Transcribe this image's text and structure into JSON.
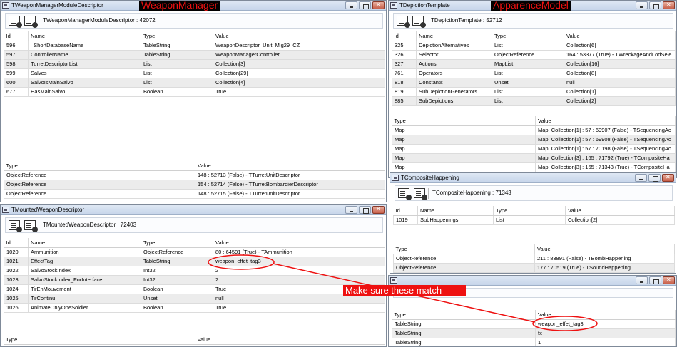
{
  "windows": {
    "weapon_manager": {
      "title": "TWeaponManagerModuleDescriptor",
      "red_label": "WeaponManager",
      "toolbar_title": "TWeaponManagerModuleDescriptor : 42072",
      "headers": [
        "Id",
        "Name",
        "Type",
        "Value"
      ],
      "rows": [
        [
          "596",
          "_ShortDatabaseName",
          "TableString",
          "WeaponDescriptor_Unit_Mig29_CZ"
        ],
        [
          "597",
          "ControllerName",
          "TableString",
          "WeaponManagerController"
        ],
        [
          "598",
          "TurretDescriptorList",
          "List",
          "Collection[3]"
        ],
        [
          "599",
          "Salves",
          "List",
          "Collection[29]"
        ],
        [
          "600",
          "SalvoIsMainSalvo",
          "List",
          "Collection[4]"
        ],
        [
          "677",
          "HasMainSalvo",
          "Boolean",
          "True"
        ]
      ],
      "sub_headers": [
        "Type",
        "Value"
      ],
      "sub_rows": [
        [
          "ObjectReference",
          "148 : 52713 (False) - TTurretUnitDescriptor"
        ],
        [
          "ObjectReference",
          "154 : 52714 (False) - TTurretBombardierDescriptor"
        ],
        [
          "ObjectReference",
          "148 : 52715 (False) - TTurretUnitDescriptor"
        ]
      ]
    },
    "mounted_weapon": {
      "title": "TMountedWeaponDescriptor",
      "toolbar_title": "TMountedWeaponDescriptor : 72403",
      "headers": [
        "Id",
        "Name",
        "Type",
        "Value"
      ],
      "rows": [
        [
          "1020",
          "Ammunition",
          "ObjectReference",
          "80 : 64591 (True) - TAmmunition"
        ],
        [
          "1021",
          "EffectTag",
          "TableString",
          "weapon_effet_tag3"
        ],
        [
          "1022",
          "SalvoStockIndex",
          "Int32",
          "2"
        ],
        [
          "1023",
          "SalvoStockIndex_ForInterface",
          "Int32",
          "2"
        ],
        [
          "1024",
          "TirEnMouvement",
          "Boolean",
          "True"
        ],
        [
          "1025",
          "TirContinu",
          "Unset",
          "null"
        ],
        [
          "1026",
          "AnimateOnlyOneSoldier",
          "Boolean",
          "True"
        ]
      ],
      "sub_headers": [
        "Type",
        "Value"
      ]
    },
    "depiction": {
      "title": "TDepictionTemplate",
      "red_label": "ApparenceModel",
      "toolbar_title": "TDepictionTemplate : 52712",
      "headers": [
        "Id",
        "Name",
        "Type",
        "Value"
      ],
      "rows": [
        [
          "325",
          "DepictionAlternatives",
          "List",
          "Collection[6]"
        ],
        [
          "326",
          "Selector",
          "ObjectReference",
          "164 : 53377 (True) - TWreckageAndLodSele"
        ],
        [
          "327",
          "Actions",
          "MapList",
          "Collection[16]"
        ],
        [
          "761",
          "Operators",
          "List",
          "Collection[8]"
        ],
        [
          "818",
          "Constants",
          "Unset",
          "null"
        ],
        [
          "819",
          "SubDepictionGenerators",
          "List",
          "Collection[1]"
        ],
        [
          "885",
          "SubDepictions",
          "List",
          "Collection[2]"
        ]
      ],
      "sub_headers": [
        "Type",
        "Value"
      ],
      "sub_rows": [
        [
          "Map",
          "Map: Collection[1] : 57 : 69907 (False) - TSequencingAc"
        ],
        [
          "Map",
          "Map: Collection[1] : 57 : 69908 (False) - TSequencingAc"
        ],
        [
          "Map",
          "Map: Collection[1] : 57 : 70198 (False) - TSequencingAc"
        ],
        [
          "Map",
          "Map: Collection[3] : 165 : 71792 (True) - TCompositeHa"
        ],
        [
          "Map",
          "Map: Collection[3] : 165 : 71343 (True) - TCompositeHa"
        ]
      ]
    },
    "composite": {
      "title": "TCompositeHappening",
      "toolbar_title": "TCompositeHappening : 71343",
      "headers": [
        "Id",
        "Name",
        "Type",
        "Value"
      ],
      "rows": [
        [
          "1019",
          "SubHappenings",
          "List",
          "Collection[2]"
        ]
      ],
      "sub_headers": [
        "Type",
        "Value"
      ],
      "sub_rows": [
        [
          "ObjectReference",
          "211 : 83891 (False) - TBombHappening"
        ],
        [
          "ObjectReference",
          "177 : 70519 (True) - TSoundHappening"
        ]
      ]
    },
    "bottom_right": {
      "headers": [
        "Type",
        "Value"
      ],
      "rows": [
        [
          "TableString",
          "weapon_effet_tag3"
        ],
        [
          "TableString",
          "fx"
        ],
        [
          "TableString",
          "1"
        ]
      ]
    }
  },
  "annotation": {
    "label": "Make sure these match",
    "color": "#ee1111"
  },
  "icons": [
    "window-icon",
    "add-item-icon",
    "remove-item-icon",
    "minimize-icon",
    "maximize-icon",
    "close-icon"
  ]
}
